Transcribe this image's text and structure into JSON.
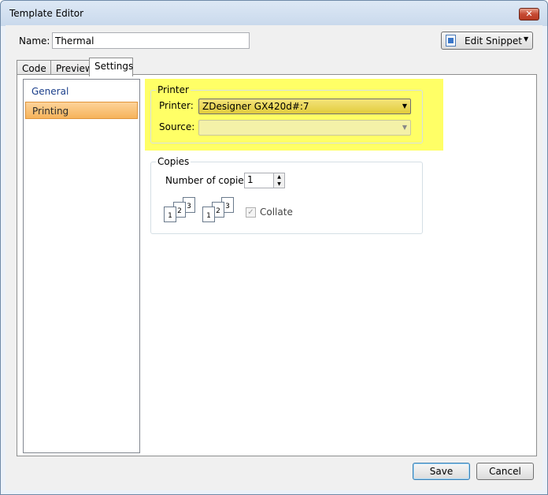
{
  "window": {
    "title": "Template Editor",
    "close_glyph": "✕"
  },
  "name_field": {
    "label": "Name:",
    "value": "Thermal"
  },
  "edit_snippet": {
    "label": "Edit Snippet",
    "arrow": "▼"
  },
  "tabs": [
    {
      "label": "Code"
    },
    {
      "label": "Preview"
    },
    {
      "label": "Settings",
      "active": true
    }
  ],
  "nav": {
    "items": [
      {
        "label": "General"
      },
      {
        "label": "Printing",
        "selected": true
      }
    ]
  },
  "printer_group": {
    "title": "Printer",
    "printer_label": "Printer:",
    "printer_value": "ZDesigner GX420d#:7",
    "source_label": "Source:",
    "source_value": "",
    "arrow": "▼"
  },
  "copies_group": {
    "title": "Copies",
    "number_label": "Number of copies:",
    "number_value": "1",
    "spin_up": "▲",
    "spin_down": "▼",
    "collate_label": "Collate",
    "collate_checked": true,
    "check_glyph": "✓",
    "pages": [
      "1",
      "2",
      "3"
    ]
  },
  "footer": {
    "save_label": "Save",
    "cancel_label": "Cancel"
  },
  "colors": {
    "highlight": "#ffff66",
    "selected_nav": "#f6b35a",
    "link_blue": "#1a3e8a"
  }
}
